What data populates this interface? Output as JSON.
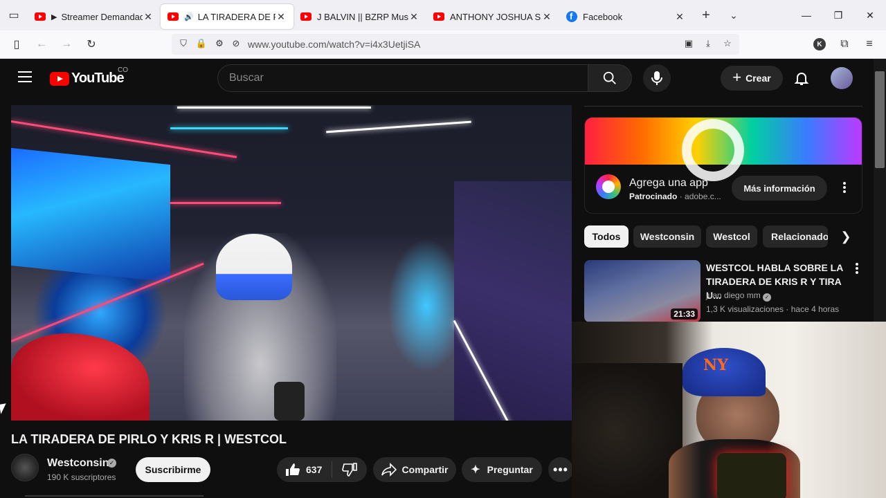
{
  "browser": {
    "tabs": [
      {
        "title": "Streamer Demandado",
        "icon": "youtube-icon",
        "audio": false,
        "active": false
      },
      {
        "title": "LA TIRADERA DE PIRLO",
        "icon": "youtube-icon",
        "audio": true,
        "active": true
      },
      {
        "title": "J BALVIN || BZRP Music Se",
        "icon": "youtube-icon",
        "audio": false,
        "active": false
      },
      {
        "title": "ANTHONY JOSHUA SUFRE",
        "icon": "youtube-icon",
        "audio": false,
        "active": false
      },
      {
        "title": "Facebook",
        "icon": "facebook-icon",
        "audio": false,
        "active": false
      }
    ],
    "url": "www.youtube.com/watch?v=i4x3UetjiSA",
    "profile_initial": "K"
  },
  "youtube": {
    "logo_text": "YouTube",
    "country_code": "CO",
    "search_placeholder": "Buscar",
    "create_label": "Crear"
  },
  "video": {
    "title": "LA TIRADERA DE PIRLO Y KRIS R | WESTCOL",
    "channel": "Westconsin",
    "subscribers": "190 K suscriptores",
    "subscribe_label": "Suscribirme",
    "likes": "637",
    "share_label": "Compartir",
    "ask_label": "Preguntar"
  },
  "ad": {
    "title": "Agrega una app",
    "sponsored": "Patrocinado",
    "domain": "· adobe.c...",
    "cta": "Más información"
  },
  "chips": [
    "Todos",
    "Westconsin",
    "Westcol",
    "Relacionado"
  ],
  "recommendation": {
    "title": "WESTCOL HABLA SOBRE LA TIRADERA DE KRIS R Y TIRA U...",
    "channel": "juan diego mm",
    "views": "1,3 K visualizaciones",
    "age": "hace 4 horas",
    "duration": "21:33"
  },
  "colors": {
    "youtube_red": "#ff0000",
    "background": "#0f0f0f",
    "pill": "#272727"
  }
}
